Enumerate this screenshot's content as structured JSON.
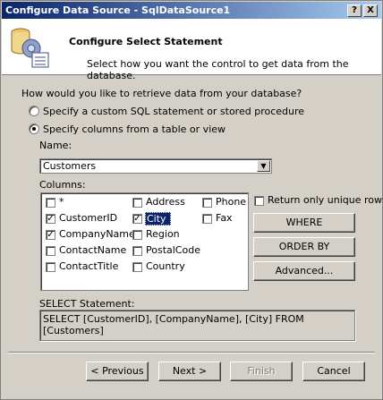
{
  "window": {
    "title": "Configure Data Source - SqlDataSource1",
    "help_label": "?",
    "close_label": "X"
  },
  "header": {
    "title": "Configure Select Statement",
    "subtitle": "Select how you want the control to get data from the database."
  },
  "question": "How would you like to retrieve data from your database?",
  "options": {
    "custom_sql": {
      "label": "Specify a custom SQL statement or stored procedure",
      "selected": false
    },
    "columns_from_table": {
      "label": "Specify columns from a table or view",
      "selected": true
    }
  },
  "name_label": "Name:",
  "table_select": {
    "value": "Customers"
  },
  "columns_label": "Columns:",
  "columns": [
    {
      "label": "*",
      "checked": false
    },
    {
      "label": "CustomerID",
      "checked": true
    },
    {
      "label": "CompanyName",
      "checked": true
    },
    {
      "label": "ContactName",
      "checked": false
    },
    {
      "label": "ContactTitle",
      "checked": false
    },
    {
      "label": "Address",
      "checked": false
    },
    {
      "label": "City",
      "checked": true
    },
    {
      "label": "Region",
      "checked": false
    },
    {
      "label": "PostalCode",
      "checked": false
    },
    {
      "label": "Country",
      "checked": false
    },
    {
      "label": "Phone",
      "checked": false
    },
    {
      "label": "Fax",
      "checked": false
    }
  ],
  "unique_rows": {
    "label": "Return only unique rows",
    "checked": false
  },
  "side_buttons": {
    "where": "WHERE",
    "order_by": "ORDER BY",
    "advanced": "Advanced..."
  },
  "select_statement": {
    "label": "SELECT Statement:",
    "value": "SELECT [CustomerID], [CompanyName], [City] FROM [Customers]"
  },
  "footer": {
    "previous": "< Previous",
    "next": "Next >",
    "finish": "Finish",
    "cancel": "Cancel"
  }
}
